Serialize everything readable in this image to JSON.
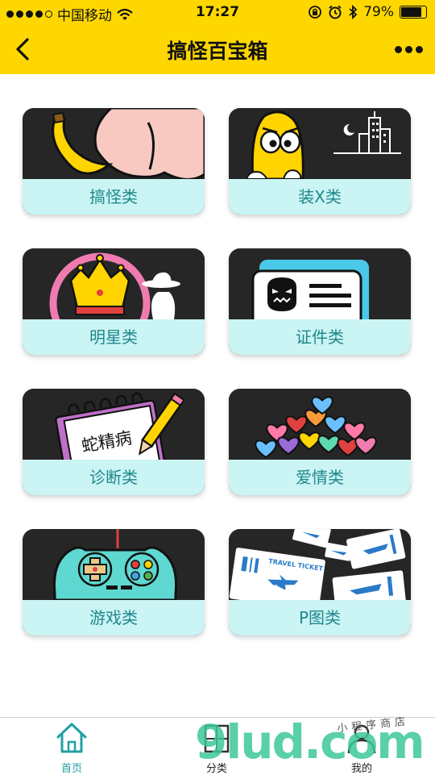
{
  "status": {
    "carrier": "中国移动",
    "time": "17:27",
    "battery": "79%",
    "battery_level": 0.79
  },
  "header": {
    "title": "搞怪百宝箱",
    "back_icon": "chevron-left-icon",
    "more_icon": "ellipsis-icon"
  },
  "categories": [
    {
      "label": "搞怪类",
      "art": "banana-butt"
    },
    {
      "label": "装X类",
      "art": "yellow-monster-city"
    },
    {
      "label": "明星类",
      "art": "crown-ring"
    },
    {
      "label": "证件类",
      "art": "id-card"
    },
    {
      "label": "诊断类",
      "art": "notepad-pencil",
      "art_text": "蛇精病"
    },
    {
      "label": "爱情类",
      "art": "heart-balloons"
    },
    {
      "label": "游戏类",
      "art": "gamepad"
    },
    {
      "label": "P图类",
      "art": "travel-tickets",
      "art_text": "TRAVEL TICKET"
    }
  ],
  "tabs": [
    {
      "label": "首页",
      "icon": "home-icon",
      "active": true
    },
    {
      "label": "分类",
      "icon": "category-icon",
      "active": false
    },
    {
      "label": "我的",
      "icon": "user-icon",
      "active": false
    }
  ],
  "watermark": {
    "text": "9lud.com",
    "subtext": "小程序商店"
  },
  "colors": {
    "brand_yellow": "#ffd700",
    "card_label_bg": "#cbf4f4",
    "card_label_text": "#20888c",
    "tab_active": "#20a0a4"
  }
}
